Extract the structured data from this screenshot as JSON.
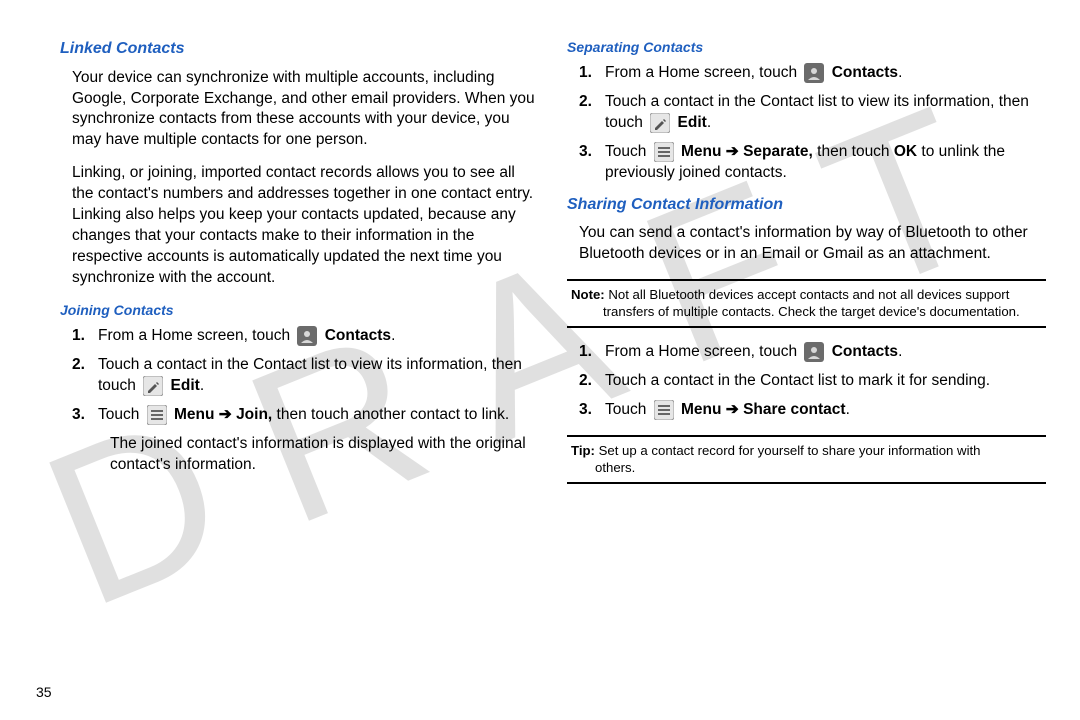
{
  "watermark": "DRAFT",
  "page_number": "35",
  "left": {
    "h_linked": "Linked Contacts",
    "p1": "Your device can synchronize with multiple accounts, including Google, Corporate Exchange, and other email providers. When you synchronize contacts from these accounts with your device, you may have multiple contacts for one person.",
    "p2": "Linking, or joining, imported contact records allows you to see all the contact's numbers and addresses together in one contact entry. Linking also helps you keep your contacts updated, because any changes that your contacts make to their information in the respective accounts is automatically updated the next time you synchronize with the account.",
    "h_joining": "Joining Contacts",
    "s1_num": "1.",
    "s1_a": "From a Home screen, touch ",
    "s1_b": "Contacts",
    "s1_c": ".",
    "s2_num": "2.",
    "s2_a": "Touch a contact in the Contact list to view its information, then touch ",
    "s2_b": "Edit",
    "s2_c": ".",
    "s3_num": "3.",
    "s3_a": "Touch ",
    "s3_b": "Menu",
    "s3_arrow": " ➔ ",
    "s3_c": "Join,",
    "s3_d": " then touch another contact to link.",
    "result": "The joined contact's information is displayed with the original contact's information."
  },
  "right": {
    "h_sep": "Separating Contacts",
    "s1_num": "1.",
    "s1_a": "From a Home screen, touch ",
    "s1_b": "Contacts",
    "s1_c": ".",
    "s2_num": "2.",
    "s2_a": "Touch a contact in the Contact list to view its information, then touch ",
    "s2_b": "Edit",
    "s2_c": ".",
    "s3_num": "3.",
    "s3_a": "Touch ",
    "s3_b": "Menu",
    "s3_arrow": " ➔ ",
    "s3_c": "Separate,",
    "s3_d": " then touch ",
    "s3_e": "OK",
    "s3_f": " to unlink the previously joined contacts.",
    "h_share": "Sharing Contact Information",
    "p_share": "You can send a contact's information by way of Bluetooth to other Bluetooth devices or in an Email or Gmail as an attachment.",
    "note_lbl": "Note:",
    "note_txt1": " Not all Bluetooth devices accept contacts and not all devices support",
    "note_txt2": "transfers of multiple contacts. Check the target device's documentation.",
    "b1_num": "1.",
    "b1_a": "From a Home screen, touch ",
    "b1_b": "Contacts",
    "b1_c": ".",
    "b2_num": "2.",
    "b2_a": "Touch a contact in the Contact list to mark it for sending.",
    "b3_num": "3.",
    "b3_a": "Touch ",
    "b3_b": "Menu",
    "b3_arrow": " ➔ ",
    "b3_c": "Share contact",
    "b3_d": ".",
    "tip_lbl": "Tip:",
    "tip_txt1": " Set up a contact record for yourself to share your information with",
    "tip_txt2": "others."
  }
}
